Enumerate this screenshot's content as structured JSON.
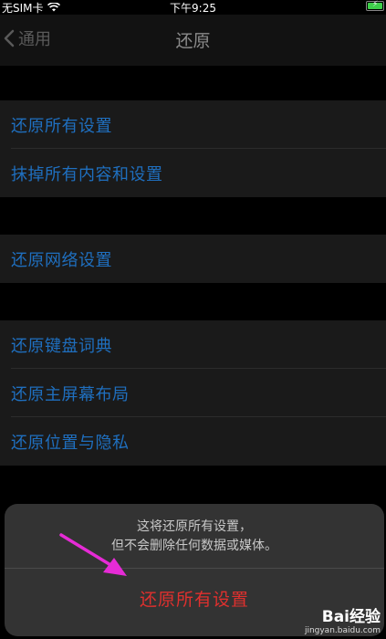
{
  "status_bar": {
    "carrier": "无SIM卡",
    "time": "下午9:25"
  },
  "nav": {
    "back_label": "通用",
    "title": "还原"
  },
  "groups": [
    {
      "items": [
        "还原所有设置",
        "抹掉所有内容和设置"
      ]
    },
    {
      "items": [
        "还原网络设置"
      ]
    },
    {
      "items": [
        "还原键盘词典",
        "还原主屏幕布局",
        "还原位置与隐私"
      ]
    }
  ],
  "action_sheet": {
    "message_line1": "这将还原所有设置，",
    "message_line2": "但不会删除任何数据或媒体。",
    "confirm_label": "还原所有设置"
  },
  "watermark": {
    "logo": "Bai经验",
    "url": "jingyan.baidu.com"
  },
  "colors": {
    "link": "#1f6fbf",
    "destructive": "#e0302e",
    "arrow": "#e62bd6"
  }
}
